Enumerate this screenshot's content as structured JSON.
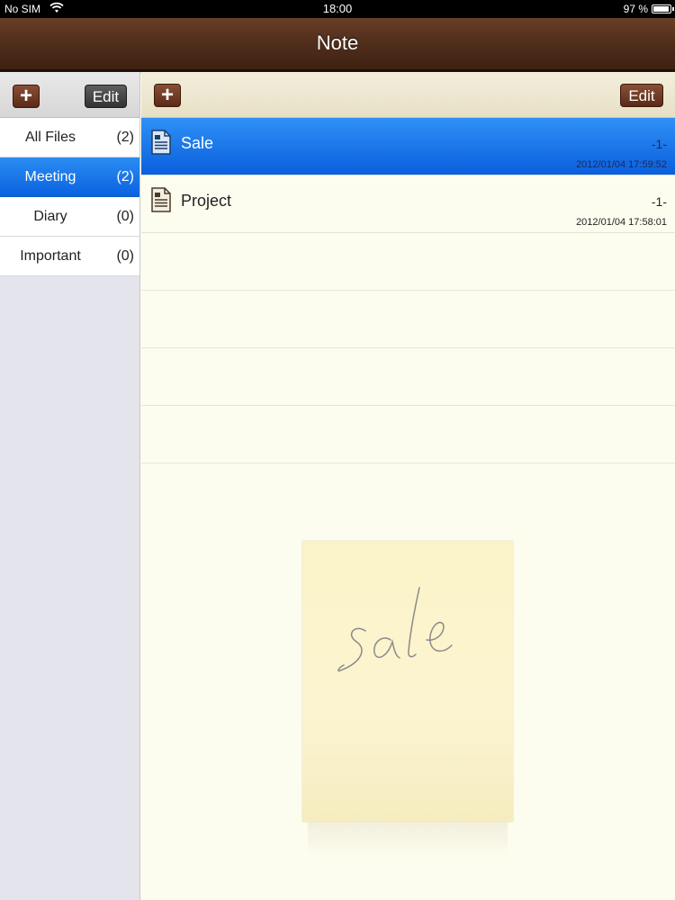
{
  "status_bar": {
    "carrier": "No SIM",
    "time": "18:00",
    "battery_percent": "97 %",
    "battery_level": 0.97
  },
  "title_bar": {
    "title": "Note"
  },
  "sidebar": {
    "toolbar": {
      "add_label": "+",
      "edit_label": "Edit"
    },
    "items": [
      {
        "label": "All Files",
        "count": "(2)",
        "selected": false
      },
      {
        "label": "Meeting",
        "count": "(2)",
        "selected": true
      },
      {
        "label": "Diary",
        "count": "(0)",
        "selected": false
      },
      {
        "label": "Important",
        "count": "(0)",
        "selected": false
      }
    ]
  },
  "main": {
    "toolbar": {
      "add_label": "+",
      "edit_label": "Edit"
    },
    "notes": [
      {
        "name": "Sale",
        "page": "-1-",
        "date": "2012/01/04 17:59:52",
        "selected": true
      },
      {
        "name": "Project",
        "page": "-1-",
        "date": "2012/01/04 17:58:01",
        "selected": false
      }
    ]
  },
  "colors": {
    "accent_blue": "#0a62df",
    "leather_brown": "#54301d",
    "paper": "#fdfdef"
  }
}
